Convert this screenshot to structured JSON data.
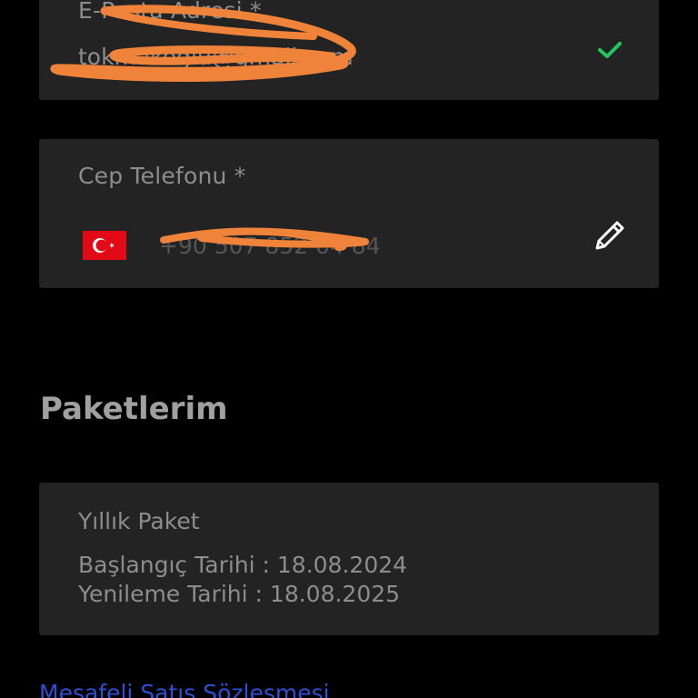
{
  "email_field": {
    "label": "E-Posta Adresi *",
    "value": "tokmakoglu@gmail.com",
    "status_icon": "check-icon"
  },
  "phone_field": {
    "label": "Cep Telefonu *",
    "flag": "turkey-flag-icon",
    "value": "+90 507 852 04 84",
    "action_icon": "pencil-icon"
  },
  "packages": {
    "title": "Paketlerim",
    "items": [
      {
        "name": "Yıllık Paket",
        "start": "Başlangıç Tarihi : 18.08.2024",
        "renewal": "Yenileme Tarihi : 18.08.2025"
      }
    ]
  },
  "links": {
    "contract": "Mesafeli Satış Sözleşmesi"
  },
  "colors": {
    "background": "#000000",
    "card": "#232323",
    "text": "#8d8d8d",
    "check": "#22c55e",
    "link": "#2c4fd6",
    "redaction": "#f0833a"
  }
}
